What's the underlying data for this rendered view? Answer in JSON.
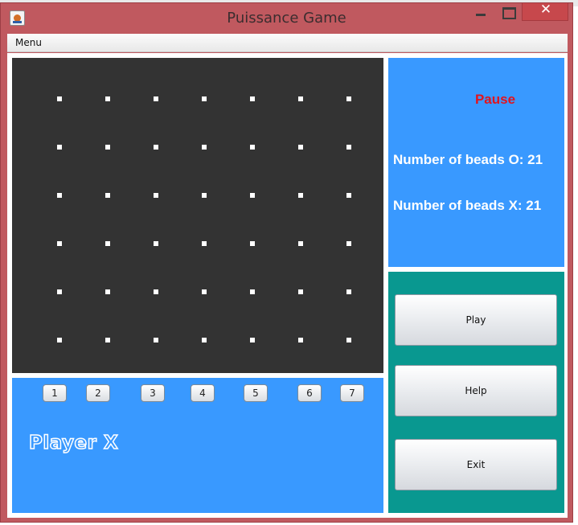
{
  "window": {
    "title": "Puissance Game",
    "close_glyph": "✕"
  },
  "menubar": {
    "menu_label": "Menu"
  },
  "board": {
    "columns": 7,
    "rows": 6
  },
  "column_buttons": [
    "1",
    "2",
    "3",
    "4",
    "5",
    "6",
    "7"
  ],
  "status": {
    "player": "Player X",
    "game_state": "Pause",
    "beads_o": "Number of beads O: 21",
    "beads_x": "Number of beads X: 21"
  },
  "actions": {
    "play": "Play",
    "help": "Help",
    "exit": "Exit"
  },
  "colors": {
    "board": "#333333",
    "panel_blue": "#3999ff",
    "panel_teal": "#099890",
    "pause_red": "#e2141e",
    "window_frame": "#c0595f"
  }
}
